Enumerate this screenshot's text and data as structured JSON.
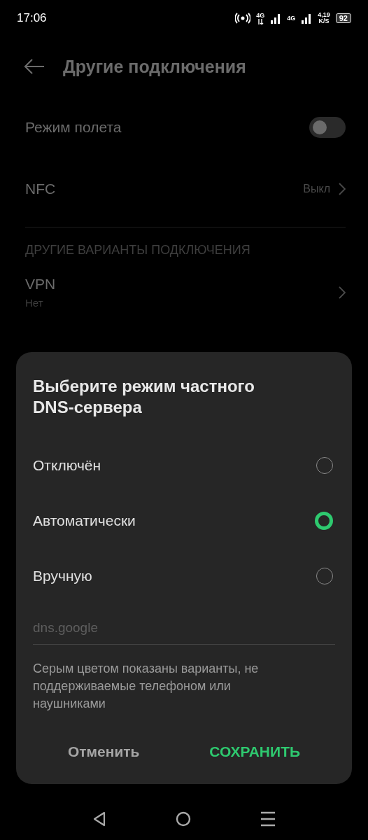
{
  "status_bar": {
    "time": "17:06",
    "network_1": "4G",
    "network_2": "4G",
    "speed_value": "4,19",
    "speed_unit": "K/S",
    "battery": "92"
  },
  "header": {
    "title": "Другие подключения"
  },
  "settings": [
    {
      "kind": "toggle",
      "label": "Режим полета",
      "on": false
    },
    {
      "kind": "link",
      "label": "NFC",
      "value": "Выкл"
    }
  ],
  "section": {
    "title": "ДРУГИЕ ВАРИАНТЫ ПОДКЛЮЧЕНИЯ",
    "items": [
      {
        "label": "VPN",
        "subtitle": "Нет"
      }
    ]
  },
  "dialog": {
    "title": "Выберите режим частного DNS-сервера",
    "options": [
      {
        "label": "Отключён",
        "selected": false
      },
      {
        "label": "Автоматически",
        "selected": true
      },
      {
        "label": "Вручную",
        "selected": false
      }
    ],
    "hostname": {
      "placeholder": "dns.google"
    },
    "note": "Серым цветом показаны варианты, не поддерживаемые телефоном или наушниками",
    "buttons": [
      {
        "kind": "cancel",
        "label": "Отменить"
      },
      {
        "kind": "confirm",
        "label": "СОХРАНИТЬ"
      }
    ]
  }
}
